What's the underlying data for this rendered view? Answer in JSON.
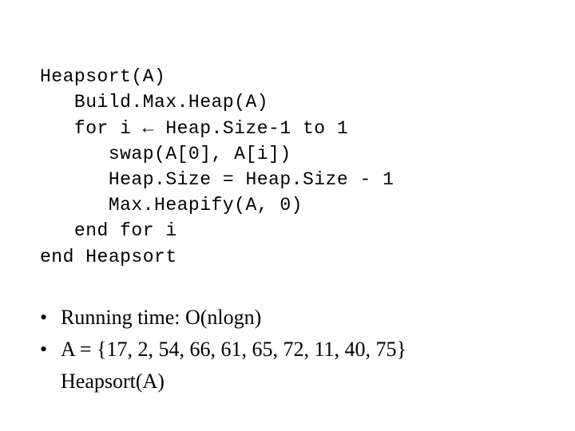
{
  "code": {
    "l0": "Heapsort(A)",
    "l1": "   Build.Max.Heap(A)",
    "l2": "   for i ← Heap.Size-1 to 1",
    "l3": "      swap(A[0], A[i])",
    "l4": "      Heap.Size = Heap.Size - 1",
    "l5": "      Max.Heapify(A, 0)",
    "l6": "   end for i",
    "l7": "end Heapsort"
  },
  "bullets": {
    "mark": "•",
    "b0": "Running time: O(nlogn)",
    "b1": "A = {17, 2, 54, 66, 61, 65, 72, 11, 40, 75}",
    "b2": "Heapsort(A)"
  }
}
